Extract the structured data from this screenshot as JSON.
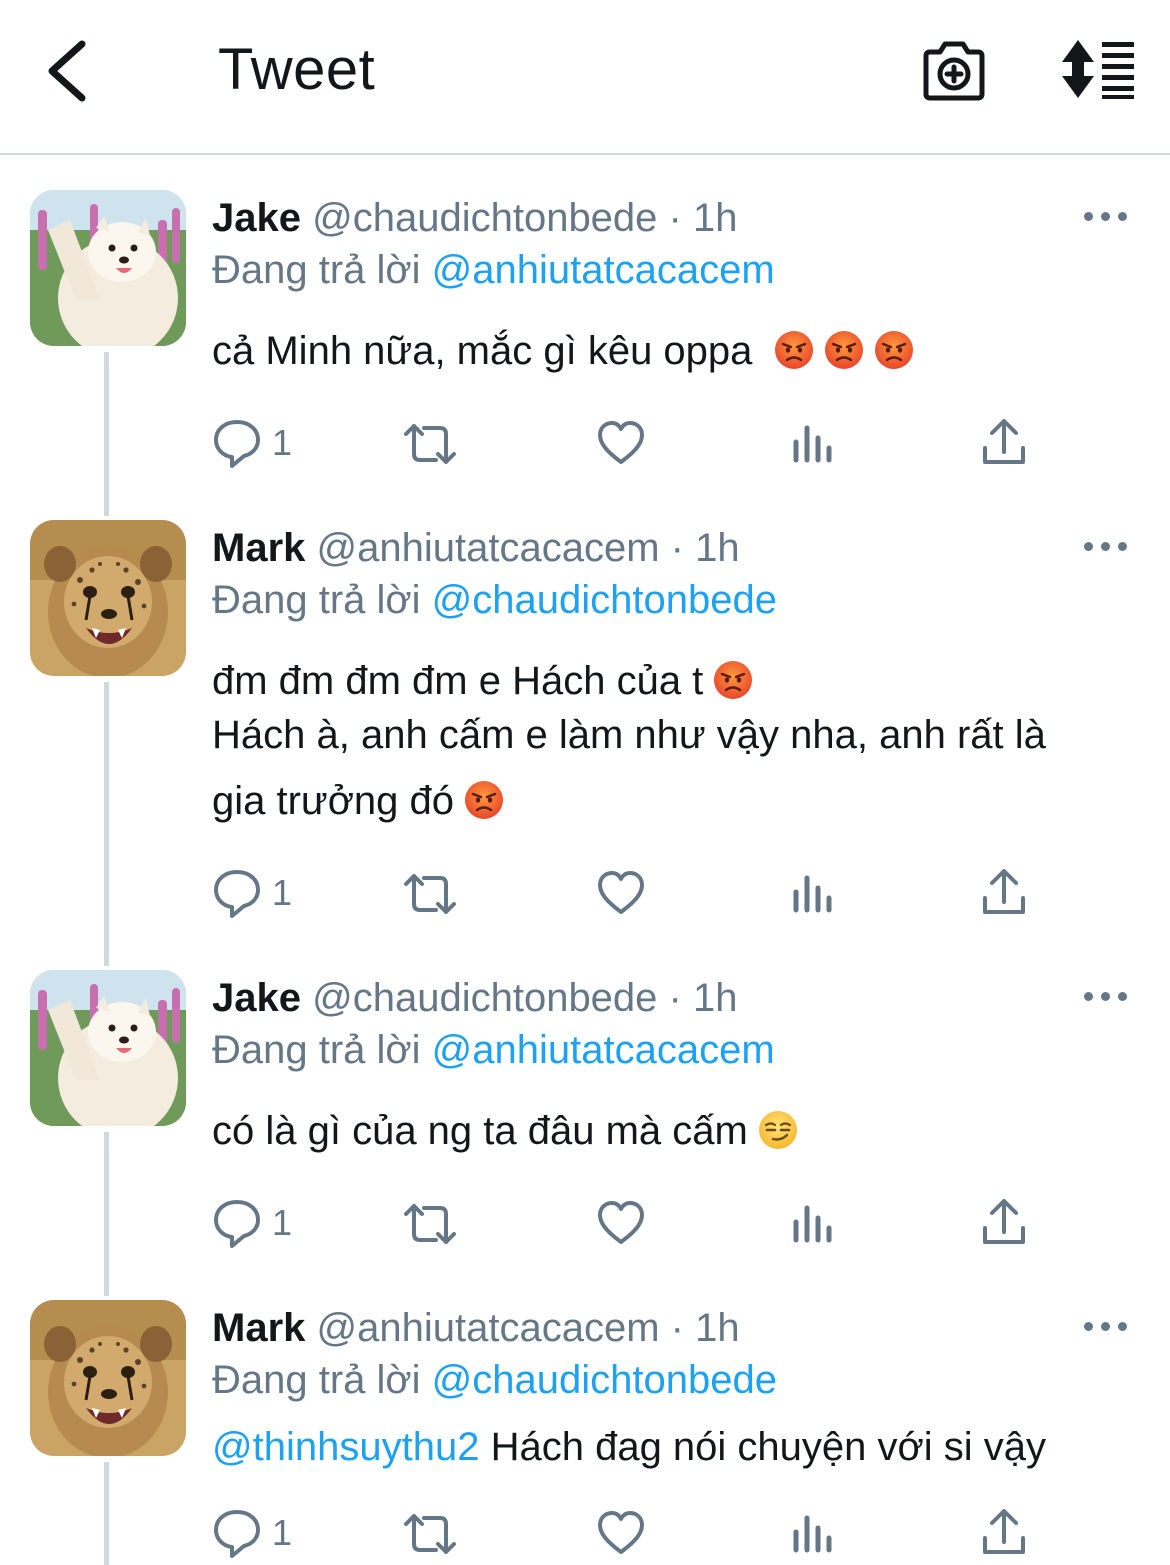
{
  "header": {
    "title": "Tweet",
    "back_icon": "chevron-left-icon",
    "camera_icon": "camera-plus-icon",
    "sort_icon": "sort-list-icon"
  },
  "colors": {
    "text": "#14171a",
    "secondary": "#657786",
    "link": "#1da1f2",
    "divider": "#d6d9dc",
    "thread_line": "#cfd9de"
  },
  "tweets": [
    {
      "author": "Jake",
      "handle": "@chaudichtonbede",
      "time": "· 1h",
      "replying_prefix": "Đang trả lời",
      "replying_to": "@anhiutatcacacem",
      "lines": [
        "cả Minh nữa, mắc gì kêu oppa"
      ],
      "emoji": "angry-face-icon ×3",
      "reply_count": "1"
    },
    {
      "author": "Mark",
      "handle": "@anhiutatcacacem",
      "time": "· 1h",
      "replying_prefix": "Đang trả lời",
      "replying_to": "@chaudichtonbede",
      "lines": [
        "đm đm đm đm e Hách của t",
        "Hách à, anh cấm e làm như vậy nha, anh rất là",
        "gia trưởng đó"
      ],
      "emoji": "angry-face-icon",
      "reply_count": "1"
    },
    {
      "author": "Jake",
      "handle": "@chaudichtonbede",
      "time": "· 1h",
      "replying_prefix": "Đang trả lời",
      "replying_to": "@anhiutatcacacem",
      "lines": [
        "có là gì của ng ta đâu mà cấm"
      ],
      "emoji": "smirk-face-icon",
      "reply_count": "1"
    },
    {
      "author": "Mark",
      "handle": "@anhiutatcacacem",
      "time": "· 1h",
      "replying_prefix": "Đang trả lời",
      "replying_to": "@chaudichtonbede",
      "mention_line": "@thinhsuythu2",
      "lines": [
        "Hách đag nói chuyện với si vậy"
      ],
      "reply_count": "1"
    }
  ]
}
